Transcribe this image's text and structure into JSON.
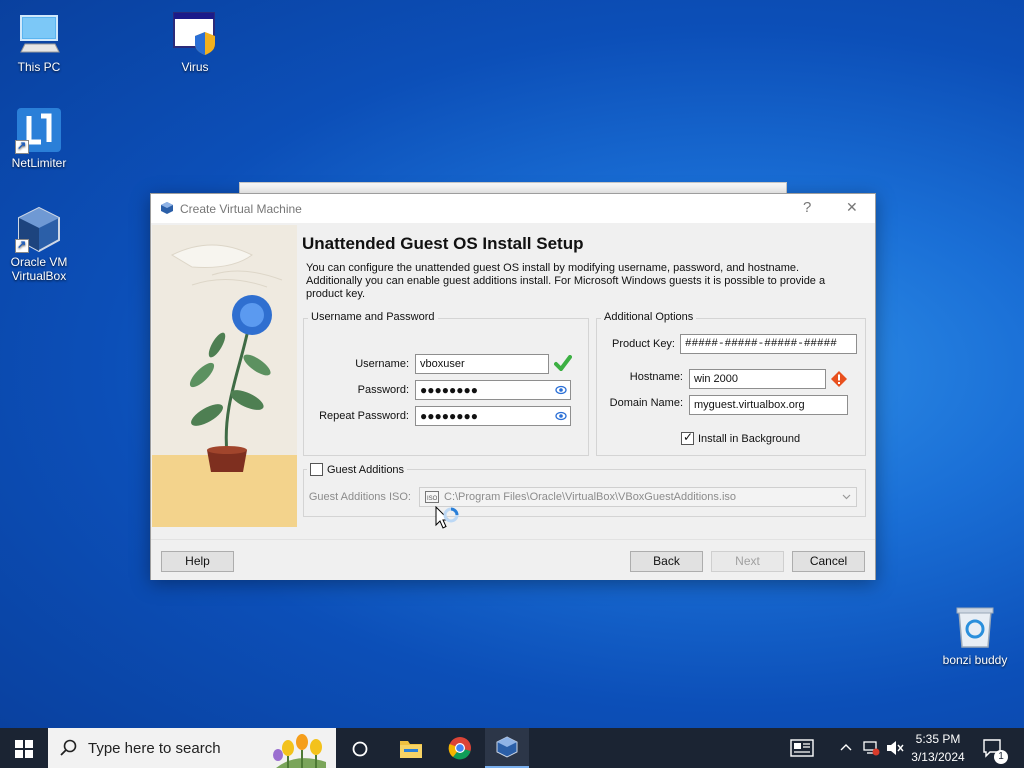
{
  "desktop": {
    "icons": [
      {
        "label": "This PC"
      },
      {
        "label": "Virus"
      },
      {
        "label": "NetLimiter"
      },
      {
        "label": "Oracle VM VirtualBox"
      },
      {
        "label": "bonzi buddy"
      }
    ]
  },
  "dialog": {
    "title": "Create Virtual Machine",
    "help_glyph": "?",
    "close_glyph": "✕",
    "heading": "Unattended Guest OS Install Setup",
    "intro": "You can configure the unattended guest OS install by modifying username, password, and hostname. Additionally you can enable guest additions install. For Microsoft Windows guests it is possible to provide a product key.",
    "user_group": {
      "title": "Username and Password",
      "username_label": "Username:",
      "username_value": "vboxuser",
      "password_label": "Password:",
      "password_value": "●●●●●●●●",
      "repeat_label": "Repeat Password:",
      "repeat_value": "●●●●●●●●"
    },
    "options_group": {
      "title": "Additional Options",
      "product_key_label": "Product Key:",
      "product_key_value": "#####-#####-#####-#####",
      "hostname_label": "Hostname:",
      "hostname_value": "win 2000",
      "domain_label": "Domain Name:",
      "domain_value": "myguest.virtualbox.org",
      "install_bg_label": "Install in Background",
      "install_bg_checked": true
    },
    "guest_additions": {
      "label": "Guest Additions",
      "checked": false,
      "iso_label": "Guest Additions ISO:",
      "iso_value": "C:\\Program Files\\Oracle\\VirtualBox\\VBoxGuestAdditions.iso"
    },
    "buttons": {
      "help": "Help",
      "back": "Back",
      "next": "Next",
      "cancel": "Cancel"
    }
  },
  "taskbar": {
    "search_placeholder": "Type here to search",
    "time": "5:35 PM",
    "date": "3/13/2024",
    "notification_count": "1"
  },
  "colors": {
    "desktop_blue": "#1a6fd6",
    "taskbar": "#1b2433",
    "ok_green": "#3cb043",
    "warn_orange": "#e8501e"
  }
}
